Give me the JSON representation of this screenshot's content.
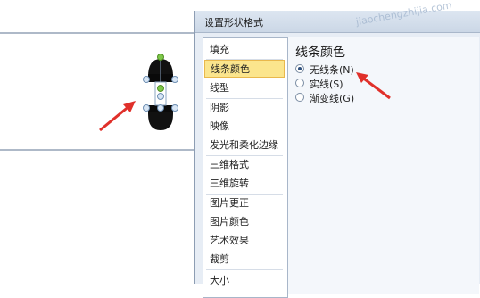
{
  "dialog": {
    "title": "设置形状格式"
  },
  "nav": {
    "items": [
      {
        "label": "填充"
      },
      {
        "label": "线条颜色",
        "selected": true
      },
      {
        "label": "线型"
      },
      {
        "label": "阴影"
      },
      {
        "label": "映像"
      },
      {
        "label": "发光和柔化边缘"
      },
      {
        "label": "三维格式"
      },
      {
        "label": "三维旋转"
      },
      {
        "label": "图片更正"
      },
      {
        "label": "图片颜色"
      },
      {
        "label": "艺术效果"
      },
      {
        "label": "裁剪"
      },
      {
        "label": "大小"
      }
    ]
  },
  "panel": {
    "title": "线条颜色",
    "options": [
      {
        "label": "无线条(N)",
        "checked": true
      },
      {
        "label": "实线(S)",
        "checked": false
      },
      {
        "label": "渐变线(G)",
        "checked": false
      }
    ]
  },
  "watermark": "jiaochengzhijia.com",
  "colors": {
    "accent_arrow": "#e0302a",
    "selection_fill": "#fbe58d",
    "selection_border": "#e9b84c",
    "shape_fill": "#111111",
    "rotation_handle": "#7ec84a"
  },
  "icons": [
    "pointer-arrow-icon",
    "radio-button-icon",
    "rotation-handle-icon"
  ]
}
